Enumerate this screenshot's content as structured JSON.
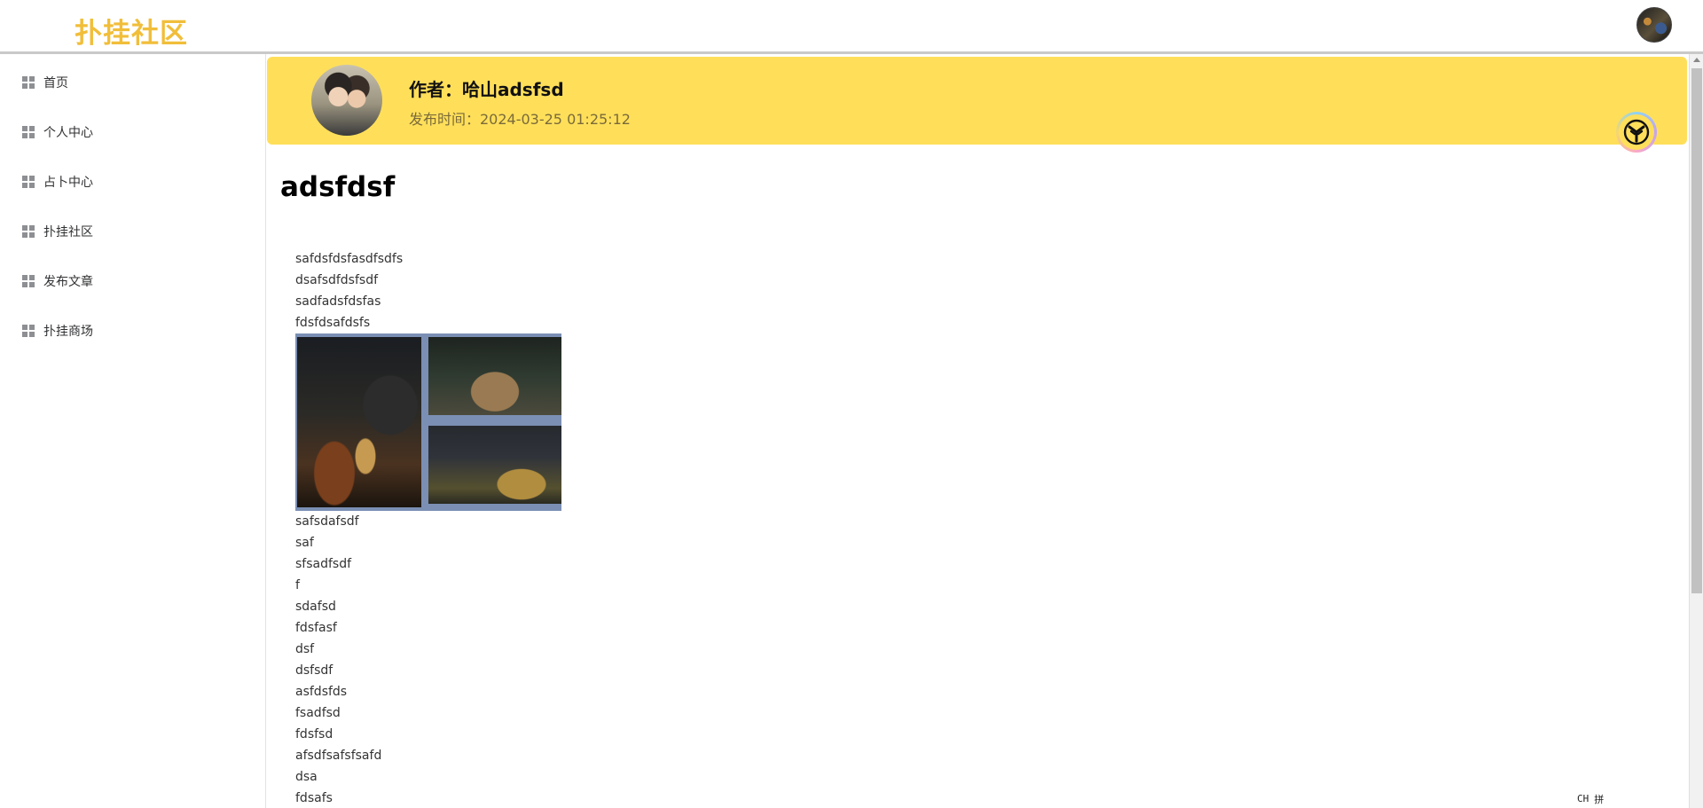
{
  "header": {
    "logo_text": "扑挂社区",
    "brand_color": "#f1be3a"
  },
  "sidebar": {
    "items": [
      {
        "label": "首页",
        "icon": "grid-icon"
      },
      {
        "label": "个人中心",
        "icon": "grid-icon"
      },
      {
        "label": "占卜中心",
        "icon": "grid-icon"
      },
      {
        "label": "扑挂社区",
        "icon": "grid-icon"
      },
      {
        "label": "发布文章",
        "icon": "grid-icon"
      },
      {
        "label": "扑挂商场",
        "icon": "grid-icon"
      }
    ]
  },
  "article": {
    "author_line": "作者：哈山adsfsd",
    "publish_line": "发布时间：2024-03-25 01:25:12",
    "banner_color": "#ffdf5a",
    "title": "adsfdsf",
    "lines_before_image": [
      "safdsfdsfasdfsdfs",
      "dsafsdfdsfsdf",
      "sadfadsfdsfas",
      "fdsfdsafdsfs"
    ],
    "lines_after_image": [
      "safsdafsdf",
      "saf",
      "sfsadfsdf",
      "f",
      "sdafsd",
      "fdsfasf",
      "dsf",
      "dsfsdf",
      "asfdsfds",
      "fsadfsd",
      "fdsfsd",
      "afsdfsafsfsafd",
      "dsa",
      "fdsafs"
    ]
  },
  "ime": {
    "mode": "CH",
    "input": "拼"
  }
}
